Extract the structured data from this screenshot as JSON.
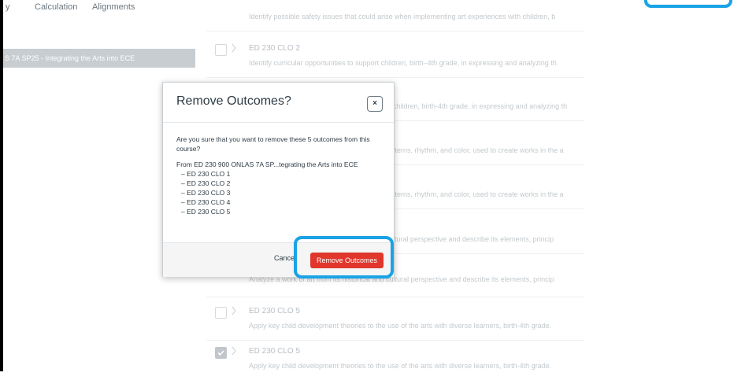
{
  "tabs": [
    {
      "label": "y"
    },
    {
      "label": "Calculation"
    },
    {
      "label": "Alignments"
    }
  ],
  "sidebar": {
    "selected_item": "S 7A SP25 - Integrating the Arts into ECE"
  },
  "outcomes": [
    {
      "title": "",
      "description": "Identify possible safety issues that could arise when implementing art experiences with children, b",
      "checked": false
    },
    {
      "title": "ED 230 CLO 2",
      "description": "Identify curricular opportunities to support children, birth–4th grade, in expressing and analyzing th",
      "checked": false
    },
    {
      "title": "",
      "description": "children, birth-4th grade, in expressing and analyzing th",
      "checked": false
    },
    {
      "title": "",
      "description": "tterns, rhythm, and color, used to create works in the a",
      "checked": false
    },
    {
      "title": "",
      "description": "tterns, rhythm, and color, used to create works in the a",
      "checked": false
    },
    {
      "title": "",
      "description": "ltural perspective and describe its elements, princip",
      "checked": false
    },
    {
      "title": "",
      "description": "Analyze a work of art from its historical and cultural perspective and describe its elements, princip",
      "checked": false
    },
    {
      "title": "ED 230 CLO 5",
      "description": "Apply key child development theories to the use of the arts with diverse learners, birth-4th grade.",
      "checked": false
    },
    {
      "title": "ED 230 CLO 5",
      "description": "Apply key child development theories to the use of the arts with diverse learners, birth-4th grade.",
      "checked": true
    }
  ],
  "modal": {
    "title": "Remove Outcomes?",
    "close_label": "×",
    "question": "Are you sure that you want to remove these 5 outcomes from this course?",
    "from_line": "From ED 230 900 ONLAS 7A SP...tegrating the Arts into ECE",
    "items": [
      "– ED 230 CLO 1",
      "– ED 230 CLO 2",
      "– ED 230 CLO 3",
      "– ED 230 CLO 4",
      "– ED 230 CLO 5"
    ],
    "cancel_label": "Cancel",
    "remove_label": "Remove Outcomes"
  },
  "colors": {
    "highlight": "#1aa3e6",
    "danger_button": "#e0362b",
    "selected_sidebar": "#c7cdd1"
  }
}
